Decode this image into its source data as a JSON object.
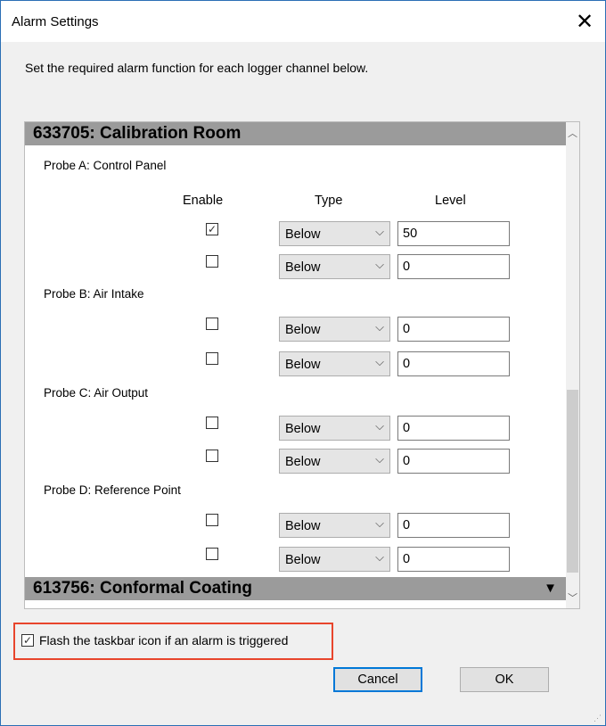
{
  "window": {
    "title": "Alarm Settings"
  },
  "instruction": "Set the required alarm function for each logger channel below.",
  "columns": {
    "enable": "Enable",
    "type": "Type",
    "level": "Level"
  },
  "groups": [
    {
      "title": "633705: Calibration Room"
    },
    {
      "title": "613756: Conformal Coating",
      "arrow": "▼"
    }
  ],
  "probes": [
    {
      "label": "Probe A: Control Panel",
      "rows": [
        {
          "enabled": true,
          "type": "Below",
          "level": "50"
        },
        {
          "enabled": false,
          "type": "Below",
          "level": "0"
        }
      ]
    },
    {
      "label": "Probe B: Air Intake",
      "rows": [
        {
          "enabled": false,
          "type": "Below",
          "level": "0"
        },
        {
          "enabled": false,
          "type": "Below",
          "level": "0"
        }
      ]
    },
    {
      "label": "Probe C: Air Output",
      "rows": [
        {
          "enabled": false,
          "type": "Below",
          "level": "0"
        },
        {
          "enabled": false,
          "type": "Below",
          "level": "0"
        }
      ]
    },
    {
      "label": "Probe D: Reference Point",
      "rows": [
        {
          "enabled": false,
          "type": "Below",
          "level": "0"
        },
        {
          "enabled": false,
          "type": "Below",
          "level": "0"
        }
      ]
    }
  ],
  "flash": {
    "checked": true,
    "label": "Flash the taskbar icon if an alarm is triggered"
  },
  "buttons": {
    "cancel": "Cancel",
    "ok": "OK"
  },
  "icons": {
    "close": "close-icon",
    "check": "checkmark-icon",
    "dropdown": "chevron-down-icon",
    "scroll_up": "chevron-up-icon",
    "scroll_down": "chevron-down-icon"
  },
  "colors": {
    "highlight_border": "#e8452c",
    "group_header": "#9b9b9b",
    "focus_border": "#0078d7"
  }
}
